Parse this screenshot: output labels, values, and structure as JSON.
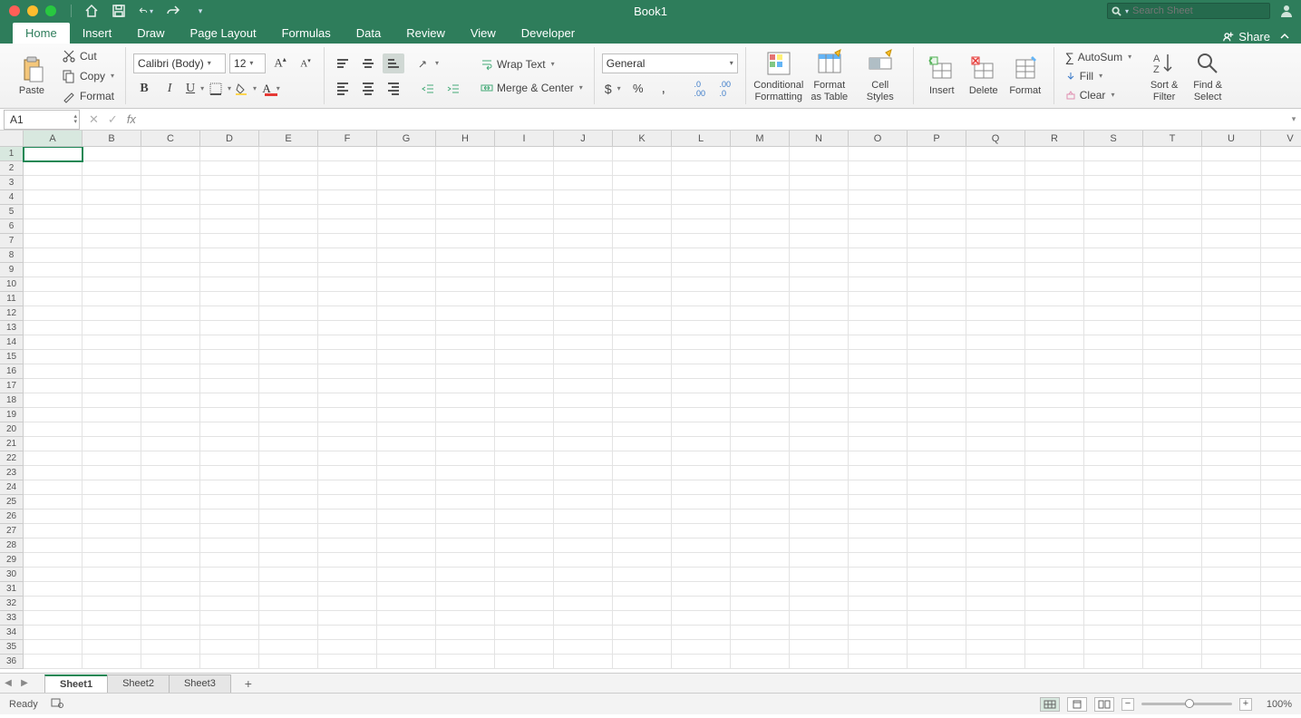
{
  "window": {
    "title": "Book1"
  },
  "search": {
    "placeholder": "Search Sheet"
  },
  "tabs": [
    "Home",
    "Insert",
    "Draw",
    "Page Layout",
    "Formulas",
    "Data",
    "Review",
    "View",
    "Developer"
  ],
  "active_tab": "Home",
  "share_label": "Share",
  "clipboard": {
    "paste": "Paste",
    "cut": "Cut",
    "copy": "Copy",
    "format": "Format"
  },
  "font": {
    "family": "Calibri (Body)",
    "size": "12"
  },
  "alignment": {
    "wrap": "Wrap Text",
    "merge": "Merge & Center"
  },
  "number": {
    "format": "General"
  },
  "styles": {
    "conditional_l1": "Conditional",
    "conditional_l2": "Formatting",
    "fat_l1": "Format",
    "fat_l2": "as Table",
    "cell_l1": "Cell",
    "cell_l2": "Styles"
  },
  "cells": {
    "insert": "Insert",
    "delete": "Delete",
    "format": "Format"
  },
  "editing": {
    "autosum": "AutoSum",
    "fill": "Fill",
    "clear": "Clear",
    "sort_l1": "Sort &",
    "sort_l2": "Filter",
    "find_l1": "Find &",
    "find_l2": "Select"
  },
  "namebox": "A1",
  "fx_label": "fx",
  "columns": [
    "A",
    "B",
    "C",
    "D",
    "E",
    "F",
    "G",
    "H",
    "I",
    "J",
    "K",
    "L",
    "M",
    "N",
    "O",
    "P",
    "Q",
    "R",
    "S",
    "T",
    "U",
    "V"
  ],
  "row_count": 36,
  "active_cell": {
    "col": "A",
    "row": 1
  },
  "sheets": [
    "Sheet1",
    "Sheet2",
    "Sheet3"
  ],
  "active_sheet": "Sheet1",
  "status": {
    "ready": "Ready",
    "zoom": "100%"
  }
}
